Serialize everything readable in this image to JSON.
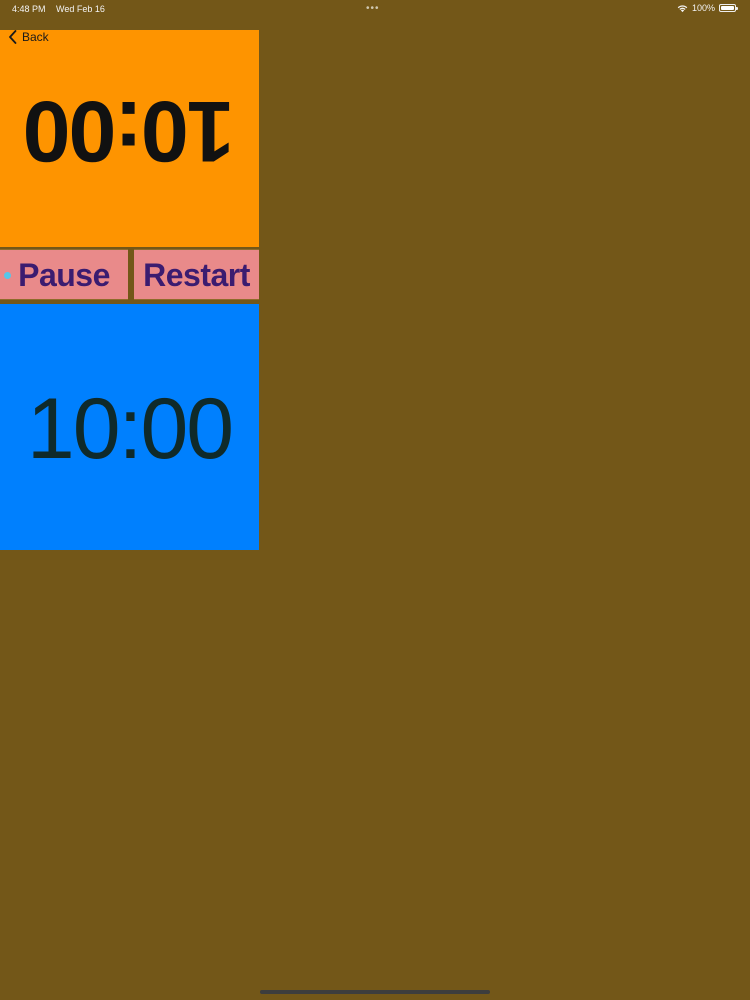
{
  "status_bar": {
    "time": "4:48 PM",
    "date": "Wed Feb 16",
    "battery": "100%",
    "icons": [
      "wifi-icon",
      "battery-icon"
    ]
  },
  "nav": {
    "back_label": "Back",
    "back_icon": "chevron-left-icon"
  },
  "timers": {
    "top_player_time": "10:00",
    "bottom_player_time": "10:00"
  },
  "controls": {
    "pause_label": "Pause",
    "restart_label": "Restart"
  },
  "colors": {
    "background": "#735718",
    "top_player": "#fe9400",
    "bottom_player": "#0080fe",
    "button_bg": "#e98a8a",
    "button_text": "#3b1c70"
  }
}
